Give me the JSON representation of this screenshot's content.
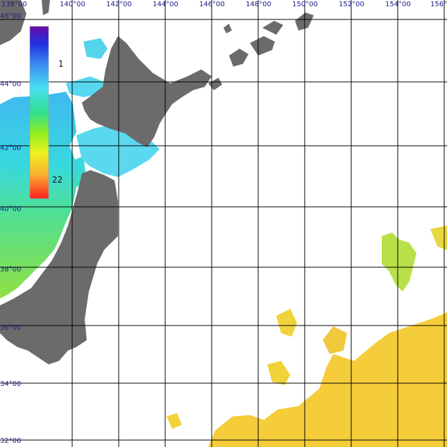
{
  "map": {
    "longitude_labels": [
      "138°00",
      "140°00",
      "142°00",
      "144°00",
      "146°00",
      "148°00",
      "150°00",
      "152°00",
      "154°00",
      "156°"
    ],
    "latitude_labels": [
      "46°00",
      "44°00",
      "42°00",
      "40°00",
      "38°00",
      "36°00",
      "34°00",
      "32°00"
    ],
    "colorbar": {
      "max_label": "1",
      "min_label": "22",
      "stops": [
        "#6a0aa8",
        "#2030e0",
        "#3a8cf0",
        "#48e0f0",
        "#30e090",
        "#90ee20",
        "#f0f020",
        "#f8b030",
        "#ff2020"
      ]
    },
    "colors": {
      "land": "#6b6b6b",
      "grid": "#000000",
      "background": "#ffffff"
    }
  }
}
